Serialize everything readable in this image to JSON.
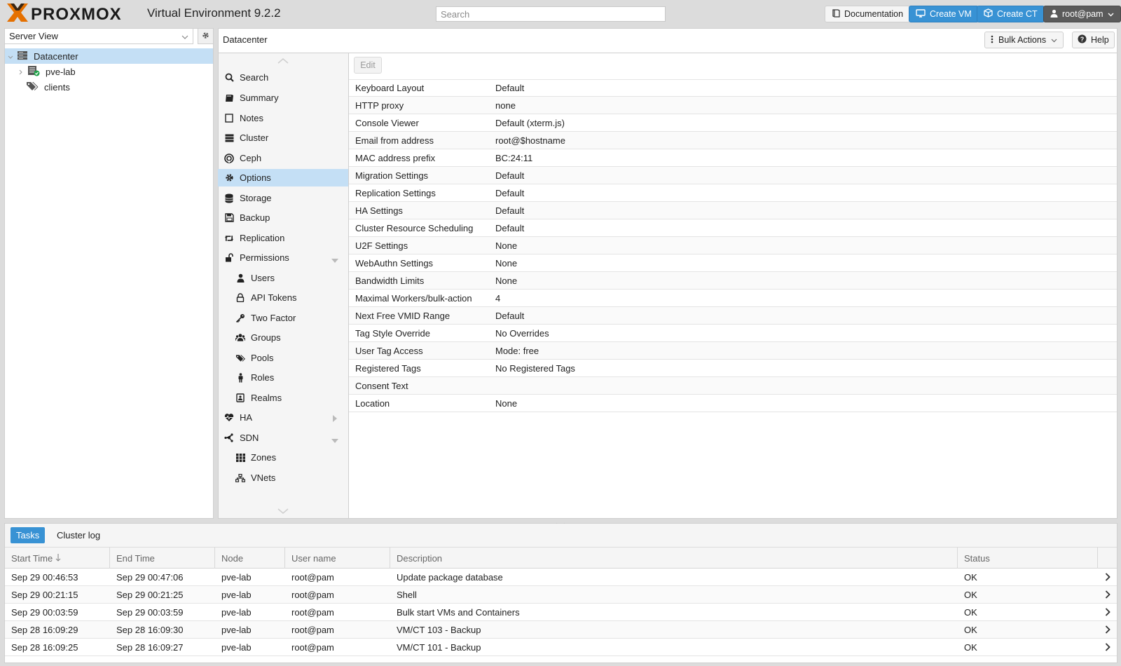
{
  "header": {
    "logo_text": "PROXMOX",
    "version": "Virtual Environment 9.2.2",
    "search_placeholder": "Search",
    "buttons": {
      "documentation": "Documentation",
      "create_vm": "Create VM",
      "create_ct": "Create CT",
      "user": "root@pam"
    }
  },
  "sidebar": {
    "view_select": "Server View",
    "tree": [
      {
        "label": "Datacenter",
        "icon": "datacenter-icon",
        "selected": true
      },
      {
        "label": "pve-lab",
        "icon": "node-online-icon"
      },
      {
        "label": "clients",
        "icon": "tags-icon"
      }
    ]
  },
  "content": {
    "breadcrumb": "Datacenter",
    "bulk_actions": "Bulk Actions",
    "help": "Help"
  },
  "nav": [
    {
      "label": "Search",
      "icon": "search-icon"
    },
    {
      "label": "Summary",
      "icon": "book-icon"
    },
    {
      "label": "Notes",
      "icon": "notes-icon"
    },
    {
      "label": "Cluster",
      "icon": "server-icon"
    },
    {
      "label": "Ceph",
      "icon": "ceph-icon"
    },
    {
      "label": "Options",
      "icon": "gear-icon",
      "selected": true
    },
    {
      "label": "Storage",
      "icon": "database-icon"
    },
    {
      "label": "Backup",
      "icon": "floppy-icon"
    },
    {
      "label": "Replication",
      "icon": "retweet-icon"
    },
    {
      "label": "Permissions",
      "icon": "unlock-icon",
      "expanded": true
    },
    {
      "label": "Users",
      "icon": "user-icon",
      "sub": true
    },
    {
      "label": "API Tokens",
      "icon": "lock-icon",
      "sub": true
    },
    {
      "label": "Two Factor",
      "icon": "key-icon",
      "sub": true
    },
    {
      "label": "Groups",
      "icon": "users-icon",
      "sub": true
    },
    {
      "label": "Pools",
      "icon": "tags-icon",
      "sub": true
    },
    {
      "label": "Roles",
      "icon": "male-icon",
      "sub": true
    },
    {
      "label": "Realms",
      "icon": "address-book-icon",
      "sub": true
    },
    {
      "label": "HA",
      "icon": "heartbeat-icon",
      "collapsed": true
    },
    {
      "label": "SDN",
      "icon": "sdn-icon",
      "expanded": true
    },
    {
      "label": "Zones",
      "icon": "zones-icon",
      "sub": true
    },
    {
      "label": "VNets",
      "icon": "vnets-icon",
      "sub": true
    }
  ],
  "options": {
    "edit_label": "Edit",
    "rows": [
      {
        "key": "Keyboard Layout",
        "value": "Default"
      },
      {
        "key": "HTTP proxy",
        "value": "none"
      },
      {
        "key": "Console Viewer",
        "value": "Default (xterm.js)"
      },
      {
        "key": "Email from address",
        "value": "root@$hostname"
      },
      {
        "key": "MAC address prefix",
        "value": "BC:24:11"
      },
      {
        "key": "Migration Settings",
        "value": "Default"
      },
      {
        "key": "Replication Settings",
        "value": "Default"
      },
      {
        "key": "HA Settings",
        "value": "Default"
      },
      {
        "key": "Cluster Resource Scheduling",
        "value": "Default"
      },
      {
        "key": "U2F Settings",
        "value": "None"
      },
      {
        "key": "WebAuthn Settings",
        "value": "None"
      },
      {
        "key": "Bandwidth Limits",
        "value": "None"
      },
      {
        "key": "Maximal Workers/bulk-action",
        "value": "4"
      },
      {
        "key": "Next Free VMID Range",
        "value": "Default"
      },
      {
        "key": "Tag Style Override",
        "value": "No Overrides"
      },
      {
        "key": "User Tag Access",
        "value": "Mode: free"
      },
      {
        "key": "Registered Tags",
        "value": "No Registered Tags"
      },
      {
        "key": "Consent Text",
        "value": ""
      },
      {
        "key": "Location",
        "value": "None"
      }
    ]
  },
  "tasks": {
    "tabs": [
      "Tasks",
      "Cluster log"
    ],
    "columns": [
      "Start Time",
      "End Time",
      "Node",
      "User name",
      "Description",
      "Status"
    ],
    "rows": [
      [
        "Sep 29 00:46:53",
        "Sep 29 00:47:06",
        "pve-lab",
        "root@pam",
        "Update package database",
        "OK"
      ],
      [
        "Sep 29 00:21:15",
        "Sep 29 00:21:25",
        "pve-lab",
        "root@pam",
        "Shell",
        "OK"
      ],
      [
        "Sep 29 00:03:59",
        "Sep 29 00:03:59",
        "pve-lab",
        "root@pam",
        "Bulk start VMs and Containers",
        "OK"
      ],
      [
        "Sep 28 16:09:29",
        "Sep 28 16:09:30",
        "pve-lab",
        "root@pam",
        "VM/CT 103 - Backup",
        "OK"
      ],
      [
        "Sep 28 16:09:25",
        "Sep 28 16:09:27",
        "pve-lab",
        "root@pam",
        "VM/CT 101 - Backup",
        "OK"
      ]
    ]
  },
  "colors": {
    "accent_blue": "#3892d4",
    "selection": "#c4dff5",
    "logo_orange": "#e57000"
  }
}
